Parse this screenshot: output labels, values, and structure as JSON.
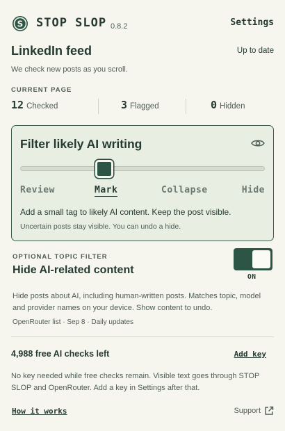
{
  "header": {
    "brand": "STOP SLOP",
    "version": "0.8.2",
    "settings_label": "Settings"
  },
  "page": {
    "title": "LinkedIn feed",
    "status": "Up to date",
    "subtitle": "We check new posts as you scroll."
  },
  "current_page": {
    "label": "CURRENT PAGE",
    "stats": [
      {
        "value": "12",
        "label": "Checked"
      },
      {
        "value": "3",
        "label": "Flagged"
      },
      {
        "value": "0",
        "label": "Hidden"
      }
    ]
  },
  "filter": {
    "title": "Filter likely AI writing",
    "levels": [
      "Review",
      "Mark",
      "Collapse",
      "Hide"
    ],
    "selected_level": "Mark",
    "slider_position": 0.34,
    "description": "Add a small tag to likely AI content. Keep the post visible.",
    "note": "Uncertain posts stay visible. You can undo a hide."
  },
  "topic": {
    "label": "OPTIONAL TOPIC FILTER",
    "title": "Hide AI-related content",
    "toggle_state": "ON",
    "description": "Hide posts about AI, including human-written posts. Matches topic, model and provider names on your device. Show content to undo.",
    "meta": "OpenRouter list · Sep 8 · Daily updates"
  },
  "credits": {
    "remaining": "4,988 free AI checks left",
    "add_key_label": "Add key",
    "description": "No key needed while free checks remain. Visible text goes through STOP SLOP and OpenRouter. Add a key in Settings after that."
  },
  "footer": {
    "how_it_works": "How it works",
    "support": "Support"
  },
  "colors": {
    "background": "#f6f6ef",
    "accent": "#2c5546",
    "text": "#253a30",
    "card": "#e8eee2"
  },
  "icons": [
    "logo-icon",
    "eye-icon",
    "external-link-icon"
  ]
}
